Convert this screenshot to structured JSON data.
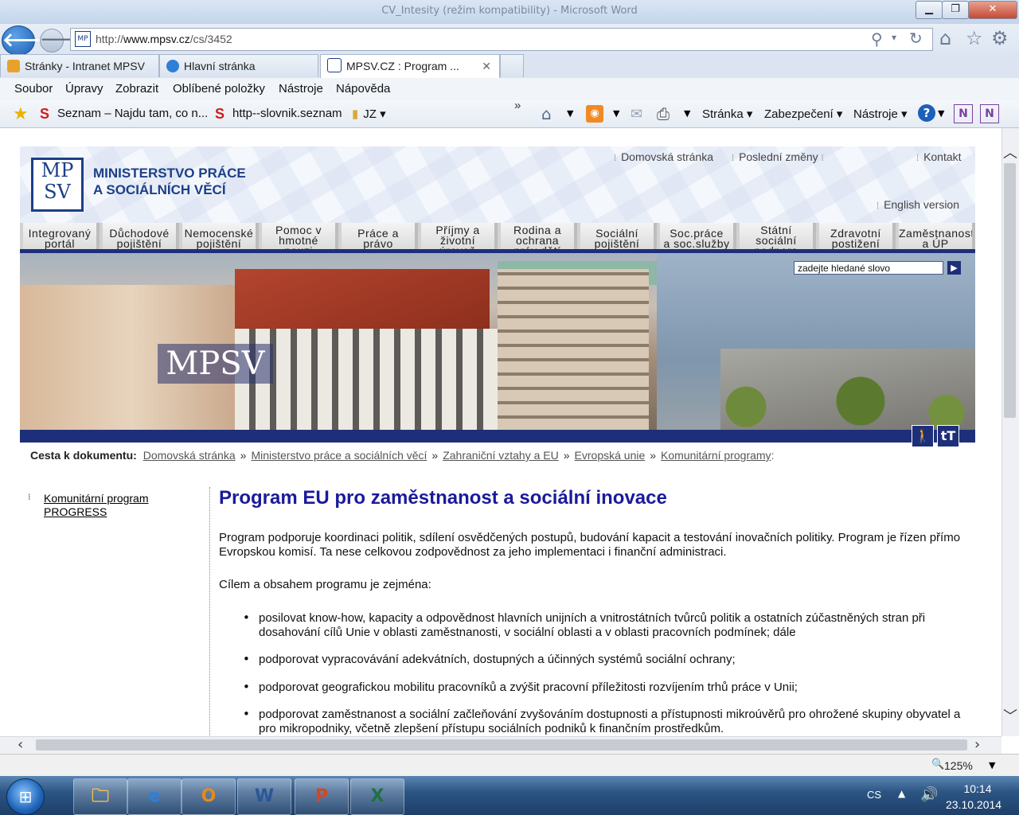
{
  "window": {
    "title": "CV_Intesity (režim kompatibility) - Microsoft Word"
  },
  "address": {
    "url_prefix": "http://",
    "url_domain": "www.mpsv.cz",
    "url_path": "/cs/3452"
  },
  "tabs": [
    {
      "label": "Stránky - Intranet MPSV",
      "icon_color": "#e8a22b"
    },
    {
      "label": "Hlavní stránka",
      "icon_color": "#2f7fd6"
    },
    {
      "label": "MPSV.CZ : Program ...",
      "icon_color": "#1c3f86",
      "close": "✕"
    }
  ],
  "menu": [
    "Soubor",
    "Úpravy",
    "Zobrazit",
    "Oblíbené položky",
    "Nástroje",
    "Nápověda"
  ],
  "favorites": [
    {
      "label": "Seznam – Najdu tam, co n..."
    },
    {
      "label": "http--slovnik.seznam"
    },
    {
      "label": "JZ"
    }
  ],
  "commandbar": {
    "page": "Stránka",
    "security": "Zabezpečení",
    "tools": "Nástroje",
    "more": "»"
  },
  "site": {
    "logo_letters_top": "MP",
    "logo_letters_bottom": "SV",
    "org_line1": "MINISTERSTVO PRÁCE",
    "org_line2": "A SOCIÁLNÍCH VĚCÍ",
    "links": {
      "home": "Domovská stránka",
      "recent": "Poslední změny",
      "contact": "Kontakt",
      "english": "English version"
    },
    "nav": [
      [
        "Integrovaný",
        "portál"
      ],
      [
        "Důchodové",
        "pojištění"
      ],
      [
        "Nemocenské",
        "pojištění"
      ],
      [
        "Pomoc v",
        "hmotné",
        "nouzi"
      ],
      [
        "Práce a",
        "právo"
      ],
      [
        "Příjmy a",
        "životní",
        "úroveň"
      ],
      [
        "Rodina a",
        "ochrana",
        "práv dětí"
      ],
      [
        "Sociální",
        "pojištění"
      ],
      [
        "Soc.práce",
        "a soc.služby"
      ],
      [
        "Státní",
        "sociální",
        "podpora"
      ],
      [
        "Zdravotní",
        "postižení"
      ],
      [
        "Zaměstnanost",
        "a ÚP"
      ]
    ],
    "banner_label": "MPSV",
    "search_placeholder": "zadejte hledané slovo",
    "search_go": "▶",
    "breadcrumb": {
      "label": "Cesta k dokumentu:",
      "items": [
        "Domovská stránka",
        "Ministerstvo práce a sociálních věcí",
        "Zahraniční vztahy a EU",
        "Evropská unie",
        "Komunitární programy"
      ],
      "separator": "»",
      "end": ":"
    },
    "leftnav": [
      "Komunitární program PROGRESS"
    ],
    "content": {
      "title": "Program EU pro zaměstnanost a sociální inovace",
      "p1": "Program podporuje koordinaci politik, sdílení osvědčených postupů, budování kapacit a testování inovačních politiky. Program je řízen přímo Evropskou komisí. Ta nese celkovou zodpovědnost za jeho implementaci i finanční administraci.",
      "p2": "Cílem a obsahem programu je zejména:",
      "bullets": [
        "posilovat know-how, kapacity a odpovědnost hlavních unijních a vnitrostátních tvůrců politik a ostatních zúčastněných stran při dosahování cílů Unie v oblasti zaměstnanosti, v sociální oblasti a v oblasti pracovních podmínek; dále",
        "podporovat vypracovávání adekvátních, dostupných a účinných systémů sociální ochrany;",
        "podporovat geografickou mobilitu pracovníků a zvýšit pracovní příležitosti rozvíjením trhů práce v Unii;",
        "podporovat zaměstnanost a sociální začleňování zvyšováním dostupnosti a přístupnosti mikroúvěrů pro ohrožené skupiny obyvatel a pro mikropodniky, včetně zlepšení přístupu sociálních podniků k finančním prostředkům."
      ]
    }
  },
  "status": {
    "zoom": "125%"
  },
  "taskbar": {
    "apps": [
      {
        "name": "explorer",
        "glyph": "🗀",
        "color": "#f2c04a"
      },
      {
        "name": "internet-explorer",
        "glyph": "e",
        "color": "#2f7fd6"
      },
      {
        "name": "outlook",
        "glyph": "O",
        "color": "#e58a1c"
      },
      {
        "name": "word",
        "glyph": "W",
        "color": "#2b5797"
      },
      {
        "name": "powerpoint",
        "glyph": "P",
        "color": "#d24726"
      },
      {
        "name": "excel",
        "glyph": "X",
        "color": "#1e7145"
      }
    ],
    "lang": "CS",
    "time": "10:14",
    "date": "23.10.2014"
  }
}
